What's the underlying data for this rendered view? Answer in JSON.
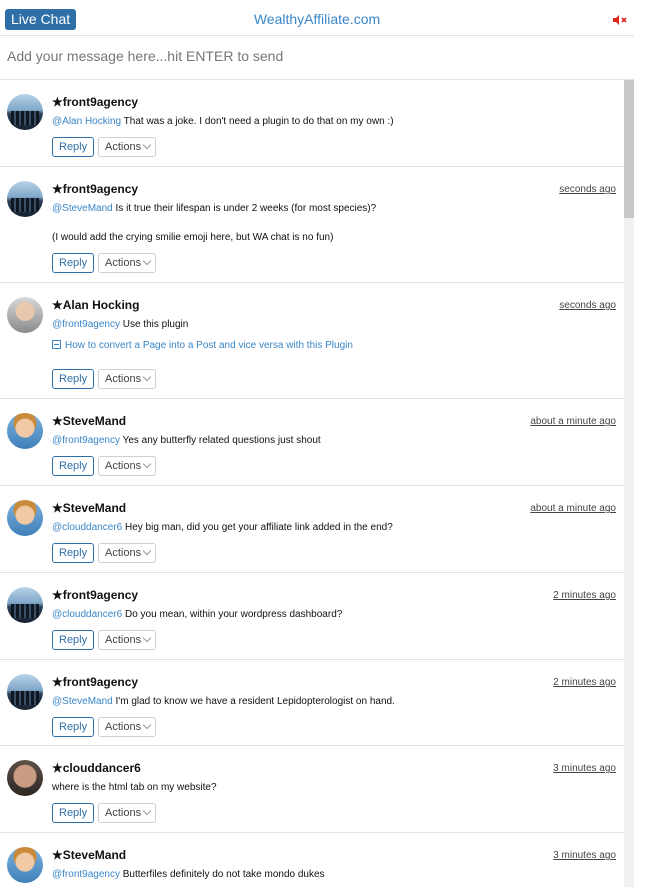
{
  "header": {
    "live_chat": "Live Chat",
    "site": "WealthyAffiliate.com",
    "mute_icon": "speaker-muted-icon"
  },
  "composer": {
    "placeholder": "Add your message here...hit ENTER to send"
  },
  "buttons": {
    "reply": "Reply",
    "actions": "Actions"
  },
  "messages": [
    {
      "author": "★front9agency",
      "time": "",
      "mention": "@Alan Hocking",
      "text": " That was a joke. I don't need a plugin to do that on my own :)"
    },
    {
      "author": "★front9agency",
      "time": "seconds ago",
      "mention": "@SteveMand",
      "text": " Is it true their lifespan is under 2 weeks (for most species)?",
      "extra": "(I would add the crying smilie emoji here, but WA chat is no fun)"
    },
    {
      "author": "★Alan Hocking",
      "time": "seconds ago",
      "mention": "@front9agency",
      "text": " Use this plugin",
      "link": "How to convert a Page into a Post and vice versa with this Plugin"
    },
    {
      "author": "★SteveMand",
      "time": "about a minute ago",
      "mention": "@front9agency",
      "text": " Yes any butterfly related questions just shout"
    },
    {
      "author": "★SteveMand",
      "time": "about a minute ago",
      "mention": "@clouddancer6",
      "text": " Hey big man, did you get your affiliate link added in the end?"
    },
    {
      "author": "★front9agency",
      "time": "2 minutes ago",
      "mention": "@clouddancer6",
      "text": " Do you mean, within your wordpress dashboard?"
    },
    {
      "author": "★front9agency",
      "time": "2 minutes ago",
      "mention": "@SteveMand",
      "text": " I'm glad to know we have a resident Lepidopterologist on hand."
    },
    {
      "author": "★clouddancer6",
      "time": "3 minutes ago",
      "mention": "",
      "text": "where is the html tab on my website?"
    },
    {
      "author": "★SteveMand",
      "time": "3 minutes ago",
      "mention": "@front9agency",
      "text": " Butterfiles definitely do not take mondo dukes"
    }
  ]
}
